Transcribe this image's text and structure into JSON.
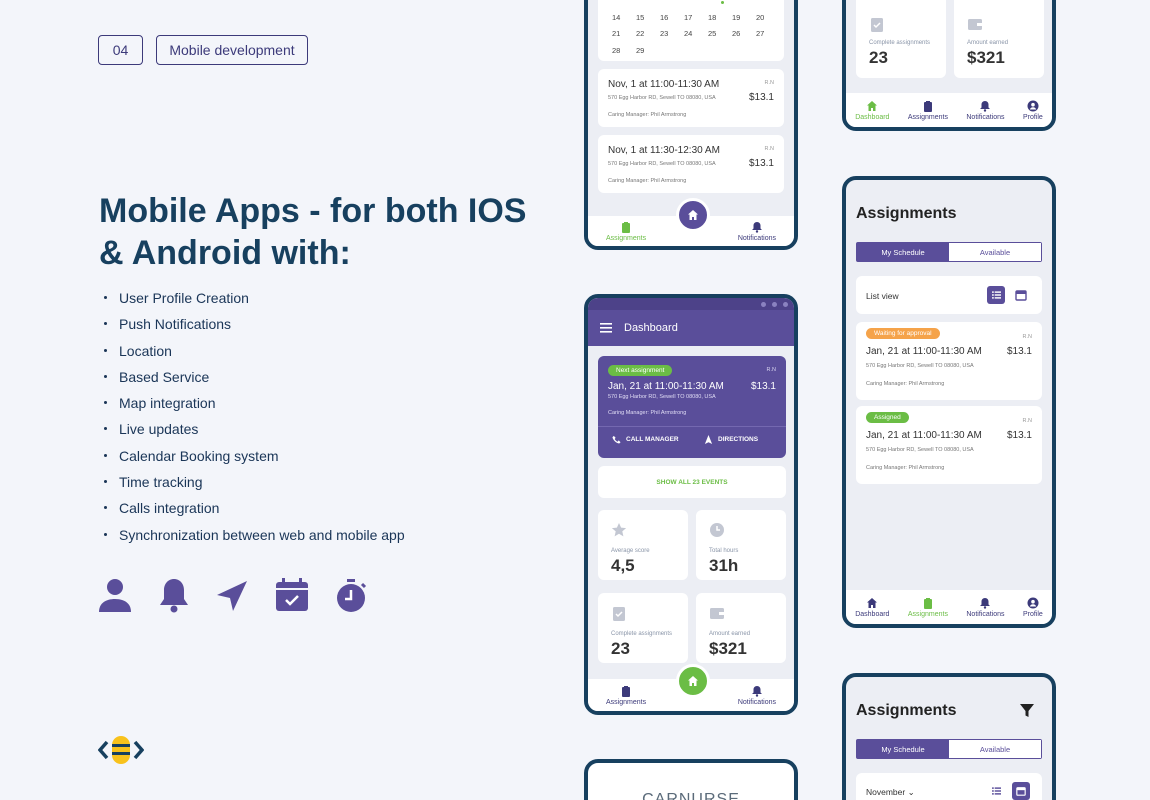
{
  "header": {
    "number": "04",
    "category": "Mobile development"
  },
  "headline": "Mobile Apps - for both IOS & Android with:",
  "features": [
    "User Profile Creation",
    "Push Notifications",
    "Location",
    "Based Service",
    "Map integration",
    "Live updates",
    "Calendar Booking system",
    "Time tracking",
    "Calls integration",
    "Synchronization between web and mobile app"
  ],
  "feature_icons": [
    "user-icon",
    "bell-icon",
    "navigation-icon",
    "calendar-check-icon",
    "stopwatch-icon"
  ],
  "colors": {
    "primary": "#5a4e9a",
    "dark": "#17405f",
    "green": "#6bbd45",
    "orange": "#f5a34a"
  },
  "calendar": {
    "row1": [
      "14",
      "15",
      "16",
      "17",
      "18",
      "19",
      "20"
    ],
    "row2": [
      "21",
      "22",
      "23",
      "24",
      "25",
      "26",
      "27"
    ],
    "row3": [
      "28",
      "29"
    ]
  },
  "phone1": {
    "items": [
      {
        "date": "Nov, 1 at 11:00-11:30 AM",
        "address": "570 Egg Harbor RD, Sewell TO 08080, USA",
        "manager": "Caring Manager:  Phil Armstrong",
        "rn": "R.N",
        "price": "$13.1"
      },
      {
        "date": "Nov, 1 at 11:30-12:30 AM",
        "address": "570 Egg Harbor RD, Sewell TO 08080, USA",
        "manager": "Caring Manager:  Phil Armstrong",
        "rn": "R.N",
        "price": "$13.1"
      }
    ],
    "nav": {
      "left": "Assignments",
      "right": "Notifications"
    }
  },
  "stats": {
    "average_label": "Average score",
    "average_value": "4,5",
    "hours_label": "Total hours",
    "hours_value": "31h",
    "complete_label": "Complete assignments",
    "complete_value": "23",
    "earned_label": "Amount earned",
    "earned_value": "$321"
  },
  "phone2": {
    "title": "Dashboard",
    "next_badge": "Next assignment",
    "next": {
      "date": "Jan, 21 at 11:00-11:30 AM",
      "address": "570 Egg Harbor RD, Sewell TO 08080, USA",
      "manager": "Caring Manager:  Phil Armstrong",
      "rn": "R.N",
      "price": "$13.1"
    },
    "call_label": "CALL MANAGER",
    "directions_label": "DIRECTIONS",
    "show_all": "SHOW ALL 23 EVENTS",
    "nav": {
      "left": "Assignments",
      "right": "Notifications"
    }
  },
  "nav4": {
    "dashboard": "Dashboard",
    "assignments": "Assignments",
    "notifications": "Notifications",
    "profile": "Profile"
  },
  "phone4": {
    "title": "Assignments",
    "seg_left": "My Schedule",
    "seg_right": "Available",
    "list_view": "List view",
    "items": [
      {
        "badge": "Waiting for approval",
        "date": "Jan, 21 at 11:00-11:30 AM",
        "address": "570 Egg Harbor RD, Sewell TO 08080, USA",
        "manager": "Caring Manager: Phil Armstrong",
        "rn": "R.N",
        "price": "$13.1"
      },
      {
        "badge": "Assigned",
        "date": "Jan, 21 at 11:00-11:30 AM",
        "address": "570 Egg Harbor RD, Sewell TO 08080, USA",
        "manager": "Caring Manager: Phil Armstrong",
        "rn": "R.N",
        "price": "$13.1"
      }
    ]
  },
  "phone5": {
    "title": "Assignments",
    "seg_left": "My Schedule",
    "seg_right": "Available",
    "month": "November"
  },
  "phone6": {
    "logo": "CARNURSE"
  }
}
